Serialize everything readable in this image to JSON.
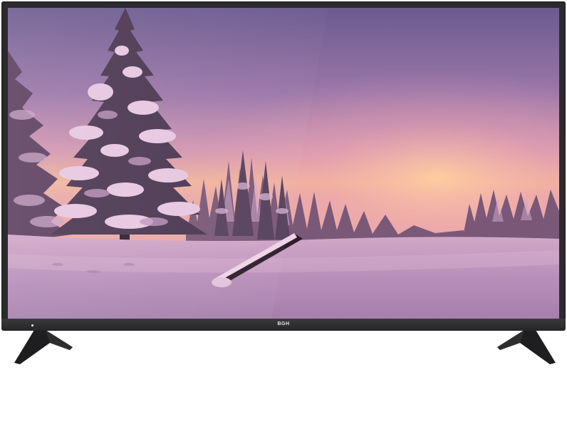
{
  "tv": {
    "brand": "BGH",
    "frame_color": "#2b2b2d",
    "screen_content": "snowy-forest-sunset-scene"
  },
  "scene": {
    "sky_top": "#6e5b8e",
    "sky_glow": "#f0b49a",
    "snow_color": "#c7a0c4",
    "tree_color": "#3b2b3c"
  }
}
